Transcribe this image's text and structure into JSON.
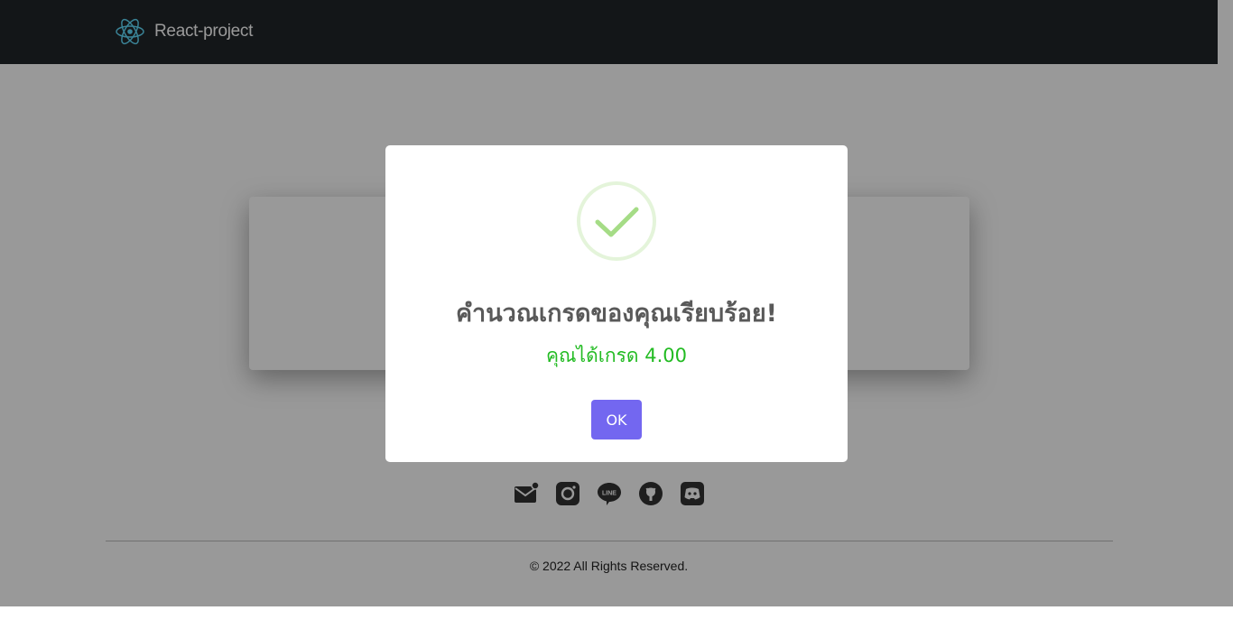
{
  "navbar": {
    "brand_label": "React-project",
    "brand_icon": "react-logo-icon",
    "background": "#212529"
  },
  "socials": [
    {
      "name": "email",
      "icon": "email-icon"
    },
    {
      "name": "instagram",
      "icon": "instagram-icon"
    },
    {
      "name": "line",
      "icon": "line-icon",
      "text": "LINE"
    },
    {
      "name": "github",
      "icon": "github-icon"
    },
    {
      "name": "discord",
      "icon": "discord-icon"
    }
  ],
  "footer": {
    "copyright": "© 2022 All Rights Reserved."
  },
  "modal": {
    "icon": "success-check-icon",
    "title": "คำนวณเกรดของคุณเรียบร้อย!",
    "text": "คุณได้เกรด 4.00",
    "confirm_label": "OK",
    "colors": {
      "title": "#595959",
      "text": "#22bb22",
      "button": "#7367f0",
      "check": "#a5dc86"
    }
  }
}
